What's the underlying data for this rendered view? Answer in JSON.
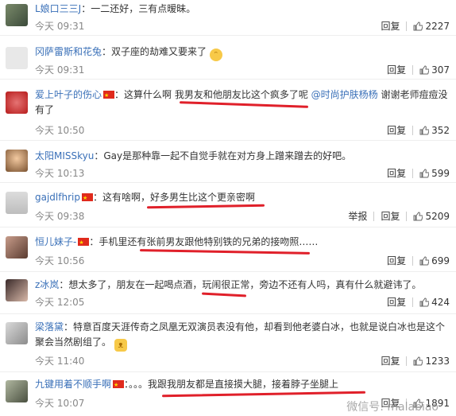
{
  "comments": [
    {
      "user": "L娘口三三J",
      "flag": false,
      "text": "：一二还好，三有点暧昧。",
      "time": "今天 09:31",
      "reply": "回复",
      "likes": "2227",
      "report": ""
    },
    {
      "user": "冈萨雷斯和花兔",
      "flag": false,
      "text": "：双子座的劫难又要来了",
      "time": "今天 09:31",
      "reply": "回复",
      "likes": "307",
      "report": ""
    },
    {
      "user": "爱上叶子的伤心",
      "flag": true,
      "text": "：这算什么啊 我男友和他朋友比这个疯多了呢 ",
      "mention": "@时尚护肤杨杨",
      "text2": " 谢谢老师痘痘没有了",
      "time": "今天 10:50",
      "reply": "回复",
      "likes": "352",
      "report": ""
    },
    {
      "user": "太阳MISSkyu",
      "flag": false,
      "text": "：Gay是那种靠一起不自觉手就在对方身上蹭来蹭去的好吧。",
      "time": "今天 10:13",
      "reply": "回复",
      "likes": "599",
      "report": ""
    },
    {
      "user": "gajdlfhrip",
      "flag": true,
      "text": "：这有啥啊，好多男生比这个更亲密啊",
      "time": "今天 09:38",
      "reply": "回复",
      "likes": "5209",
      "report": "举报"
    },
    {
      "user": "恒儿妹子-",
      "flag": true,
      "text": "：手机里还有张前男友跟他特别铁的兄弟的接吻照……",
      "time": "今天 10:56",
      "reply": "回复",
      "likes": "699",
      "report": ""
    },
    {
      "user": "z冰岚",
      "flag": false,
      "text": "：想太多了，朋友在一起喝点酒，玩闹很正常，旁边不还有人吗，真有什么就避讳了。",
      "time": "今天 12:05",
      "reply": "回复",
      "likes": "424",
      "report": ""
    },
    {
      "user": "梁落黛",
      "flag": false,
      "text": "：特意百度天涯传奇之凤凰无双演员表没有他，却看到他老婆白冰，也就是说白冰也是这个聚会当然剧组了。",
      "time": "今天 11:40",
      "reply": "回复",
      "likes": "1233",
      "report": ""
    },
    {
      "user": "九键用着不顺手啊",
      "flag": true,
      "text": "：。。。我跟我朋友都是直接摸大腿，接着脖子坐腿上",
      "time": "今天 10:07",
      "reply": "回复",
      "likes": "1891",
      "report": ""
    }
  ],
  "watermark": "微信号: malabiao",
  "colors": {
    "link": "#3a70b8",
    "underline": "#e0202a"
  }
}
